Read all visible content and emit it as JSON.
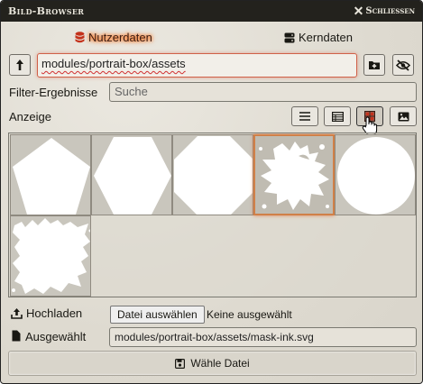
{
  "window": {
    "title": "Bild-Browser",
    "close_label": "Schliessen"
  },
  "tabs": [
    {
      "label": "Nutzerdaten",
      "icon": "database-icon",
      "active": true
    },
    {
      "label": "Kerndaten",
      "icon": "server-icon",
      "active": false
    }
  ],
  "path": {
    "value": "modules/portrait-box/assets"
  },
  "filter": {
    "label": "Filter-Ergebnisse",
    "placeholder": "Suche"
  },
  "display": {
    "label": "Anzeige",
    "modes": [
      {
        "name": "list",
        "icon": "list-icon",
        "active": false
      },
      {
        "name": "table",
        "icon": "table-icon",
        "active": false
      },
      {
        "name": "tiles",
        "icon": "tiles-icon",
        "active": true
      },
      {
        "name": "images",
        "icon": "image-icon",
        "active": false
      }
    ]
  },
  "files": [
    {
      "shape": "pentagon",
      "selected": false
    },
    {
      "shape": "hexagon",
      "selected": false
    },
    {
      "shape": "octagon",
      "selected": false
    },
    {
      "shape": "ink-splash",
      "selected": true
    },
    {
      "shape": "circle",
      "selected": false
    },
    {
      "shape": "ink-torn",
      "selected": false
    }
  ],
  "upload": {
    "label": "Hochladen",
    "button": "Datei auswählen",
    "status": "Keine ausgewählt"
  },
  "selected": {
    "label": "Ausgewählt",
    "value": "modules/portrait-box/assets/mask-ink.svg"
  },
  "submit": {
    "label": "Wähle Datei"
  },
  "colors": {
    "accent": "#ff6400",
    "titlebar": "#23221d"
  }
}
